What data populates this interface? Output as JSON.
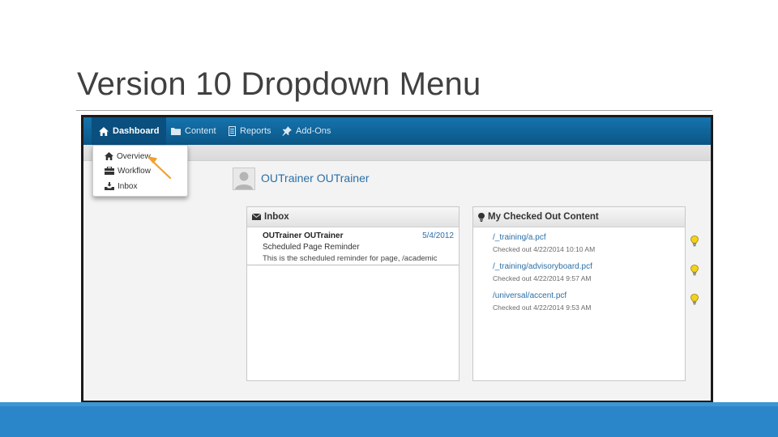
{
  "slide": {
    "title": "Version 10 Dropdown Menu"
  },
  "nav": {
    "items": [
      {
        "label": "Dashboard",
        "icon": "home-icon",
        "active": true
      },
      {
        "label": "Content",
        "icon": "folder-icon",
        "active": false
      },
      {
        "label": "Reports",
        "icon": "reports-icon",
        "active": false
      },
      {
        "label": "Add-Ons",
        "icon": "pin-icon",
        "active": false
      }
    ]
  },
  "dropdown": {
    "items": [
      {
        "label": "Overview",
        "icon": "home-icon"
      },
      {
        "label": "Workflow",
        "icon": "workflow-icon"
      },
      {
        "label": "Inbox",
        "icon": "inbox-tray-icon"
      }
    ]
  },
  "user": {
    "name": "OUTrainer OUTrainer"
  },
  "inbox_panel": {
    "title": "Inbox",
    "icon": "envelope-icon",
    "messages": [
      {
        "from": "OUTrainer OUTrainer",
        "date": "5/4/2012",
        "subject": "Scheduled Page Reminder",
        "body": "This is the scheduled reminder for page, /academic"
      }
    ]
  },
  "checked_out_panel": {
    "title": "My Checked Out Content",
    "icon": "lightbulb-icon",
    "items": [
      {
        "path": "/_training/a.pcf",
        "meta": "Checked out 4/22/2014 10:10 AM"
      },
      {
        "path": "/_training/advisoryboard.pcf",
        "meta": "Checked out 4/22/2014 9:57 AM"
      },
      {
        "path": "/universal/accent.pcf",
        "meta": "Checked out 4/22/2014 9:53 AM"
      }
    ]
  },
  "colors": {
    "nav_bar": "#0b5686",
    "nav_active": "#0a4f7d",
    "link": "#2b6fa6",
    "accent_band": "#2b86c9",
    "annotation_arrow": "#f0a030",
    "bulb": "#f2d21b"
  }
}
